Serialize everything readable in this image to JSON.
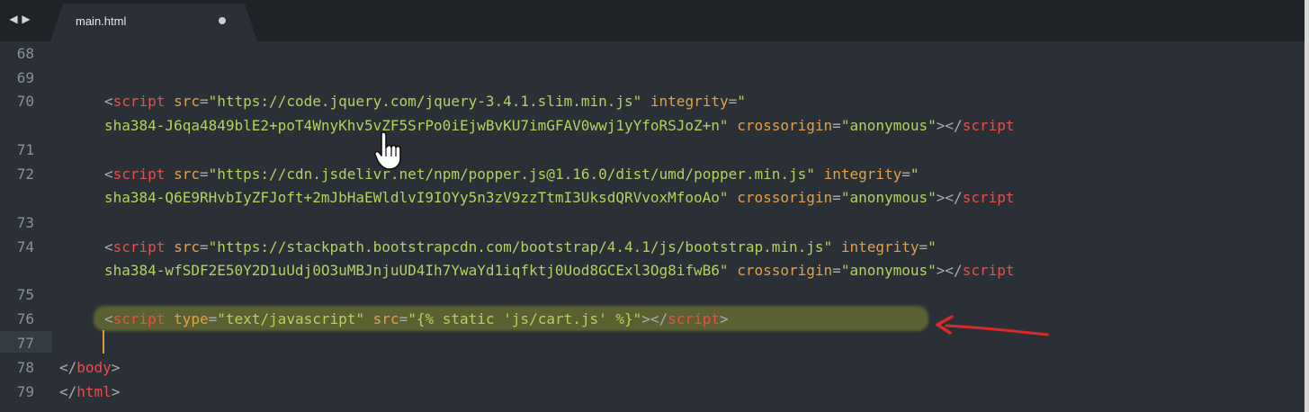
{
  "window": {
    "nav": {
      "back_glyph": "◀",
      "forward_glyph": "▶"
    },
    "tab": {
      "title": "main.html",
      "modified_indicator": "dot-icon"
    }
  },
  "editor": {
    "lines": [
      {
        "num": "68",
        "tokens": []
      },
      {
        "num": "69",
        "tokens": []
      },
      {
        "num": "70",
        "tokens": [
          {
            "t": "punct",
            "v": "<"
          },
          {
            "t": "tag",
            "v": "script"
          },
          {
            "t": "plain",
            "v": " "
          },
          {
            "t": "attr",
            "v": "src"
          },
          {
            "t": "punct",
            "v": "="
          },
          {
            "t": "str",
            "v": "\"https://code.jquery.com/jquery-3.4.1.slim.min.js\""
          },
          {
            "t": "plain",
            "v": " "
          },
          {
            "t": "attr",
            "v": "integrity"
          },
          {
            "t": "punct",
            "v": "="
          },
          {
            "t": "str",
            "v": "\""
          }
        ]
      },
      {
        "num": "",
        "tokens": [
          {
            "t": "str",
            "v": "sha384-J6qa4849blE2+poT4WnyKhv5vZF5SrPo0iEjwBvKU7imGFAV0wwj1yYfoRSJoZ+n\""
          },
          {
            "t": "plain",
            "v": " "
          },
          {
            "t": "attr",
            "v": "crossorigin"
          },
          {
            "t": "punct",
            "v": "="
          },
          {
            "t": "str",
            "v": "\"anonymous\""
          },
          {
            "t": "punct",
            "v": "></"
          },
          {
            "t": "tag",
            "v": "script"
          }
        ]
      },
      {
        "num": "71",
        "tokens": []
      },
      {
        "num": "72",
        "tokens": [
          {
            "t": "punct",
            "v": "<"
          },
          {
            "t": "tag",
            "v": "script"
          },
          {
            "t": "plain",
            "v": " "
          },
          {
            "t": "attr",
            "v": "src"
          },
          {
            "t": "punct",
            "v": "="
          },
          {
            "t": "str",
            "v": "\"https://cdn.jsdelivr.net/npm/popper.js@1.16.0/dist/umd/popper.min.js\""
          },
          {
            "t": "plain",
            "v": " "
          },
          {
            "t": "attr",
            "v": "integrity"
          },
          {
            "t": "punct",
            "v": "="
          },
          {
            "t": "str",
            "v": "\""
          }
        ]
      },
      {
        "num": "",
        "tokens": [
          {
            "t": "str",
            "v": "sha384-Q6E9RHvbIyZFJoft+2mJbHaEWldlvI9IOYy5n3zV9zzTtmI3UksdQRVvoxMfooAo\""
          },
          {
            "t": "plain",
            "v": " "
          },
          {
            "t": "attr",
            "v": "crossorigin"
          },
          {
            "t": "punct",
            "v": "="
          },
          {
            "t": "str",
            "v": "\"anonymous\""
          },
          {
            "t": "punct",
            "v": "></"
          },
          {
            "t": "tag",
            "v": "script"
          }
        ]
      },
      {
        "num": "73",
        "tokens": []
      },
      {
        "num": "74",
        "tokens": [
          {
            "t": "punct",
            "v": "<"
          },
          {
            "t": "tag",
            "v": "script"
          },
          {
            "t": "plain",
            "v": " "
          },
          {
            "t": "attr",
            "v": "src"
          },
          {
            "t": "punct",
            "v": "="
          },
          {
            "t": "str",
            "v": "\"https://stackpath.bootstrapcdn.com/bootstrap/4.4.1/js/bootstrap.min.js\""
          },
          {
            "t": "plain",
            "v": " "
          },
          {
            "t": "attr",
            "v": "integrity"
          },
          {
            "t": "punct",
            "v": "="
          },
          {
            "t": "str",
            "v": "\""
          }
        ]
      },
      {
        "num": "",
        "tokens": [
          {
            "t": "str",
            "v": "sha384-wfSDF2E50Y2D1uUdj0O3uMBJnjuUD4Ih7YwaYd1iqfktj0Uod8GCExl3Og8ifwB6\""
          },
          {
            "t": "plain",
            "v": " "
          },
          {
            "t": "attr",
            "v": "crossorigin"
          },
          {
            "t": "punct",
            "v": "="
          },
          {
            "t": "str",
            "v": "\"anonymous\""
          },
          {
            "t": "punct",
            "v": "></"
          },
          {
            "t": "tag",
            "v": "script"
          }
        ]
      },
      {
        "num": "75",
        "tokens": []
      },
      {
        "num": "76",
        "tokens": [
          {
            "t": "punct",
            "v": "<"
          },
          {
            "t": "tag",
            "v": "script"
          },
          {
            "t": "plain",
            "v": " "
          },
          {
            "t": "attr",
            "v": "type"
          },
          {
            "t": "punct",
            "v": "="
          },
          {
            "t": "str",
            "v": "\"text/javascript\""
          },
          {
            "t": "plain",
            "v": " "
          },
          {
            "t": "attr",
            "v": "src"
          },
          {
            "t": "punct",
            "v": "="
          },
          {
            "t": "str",
            "v": "\"{% static 'js/cart.js' %}\""
          },
          {
            "t": "punct",
            "v": "></"
          },
          {
            "t": "tag",
            "v": "script"
          },
          {
            "t": "punct",
            "v": ">"
          }
        ]
      },
      {
        "num": "77",
        "tokens": []
      },
      {
        "num": "78",
        "tokens": [
          {
            "t": "punct",
            "v": "</"
          },
          {
            "t": "tag",
            "v": "body"
          },
          {
            "t": "punct",
            "v": ">"
          }
        ]
      },
      {
        "num": "79",
        "tokens": [
          {
            "t": "punct",
            "v": "</"
          },
          {
            "t": "tag",
            "v": "html"
          },
          {
            "t": "punct",
            "v": ">"
          }
        ]
      }
    ]
  },
  "annotations": {
    "highlight_color": "#bcbd28",
    "arrow_color": "#d82a2a",
    "pointer": "hand-cursor-icon"
  },
  "colors": {
    "background": "#2b3036",
    "tabbar": "#1f2327",
    "tag": "#e84e4e",
    "attribute": "#e0a14a",
    "string": "#b5d15e",
    "line_number": "#8a9199",
    "caret": "#e39a3a"
  }
}
